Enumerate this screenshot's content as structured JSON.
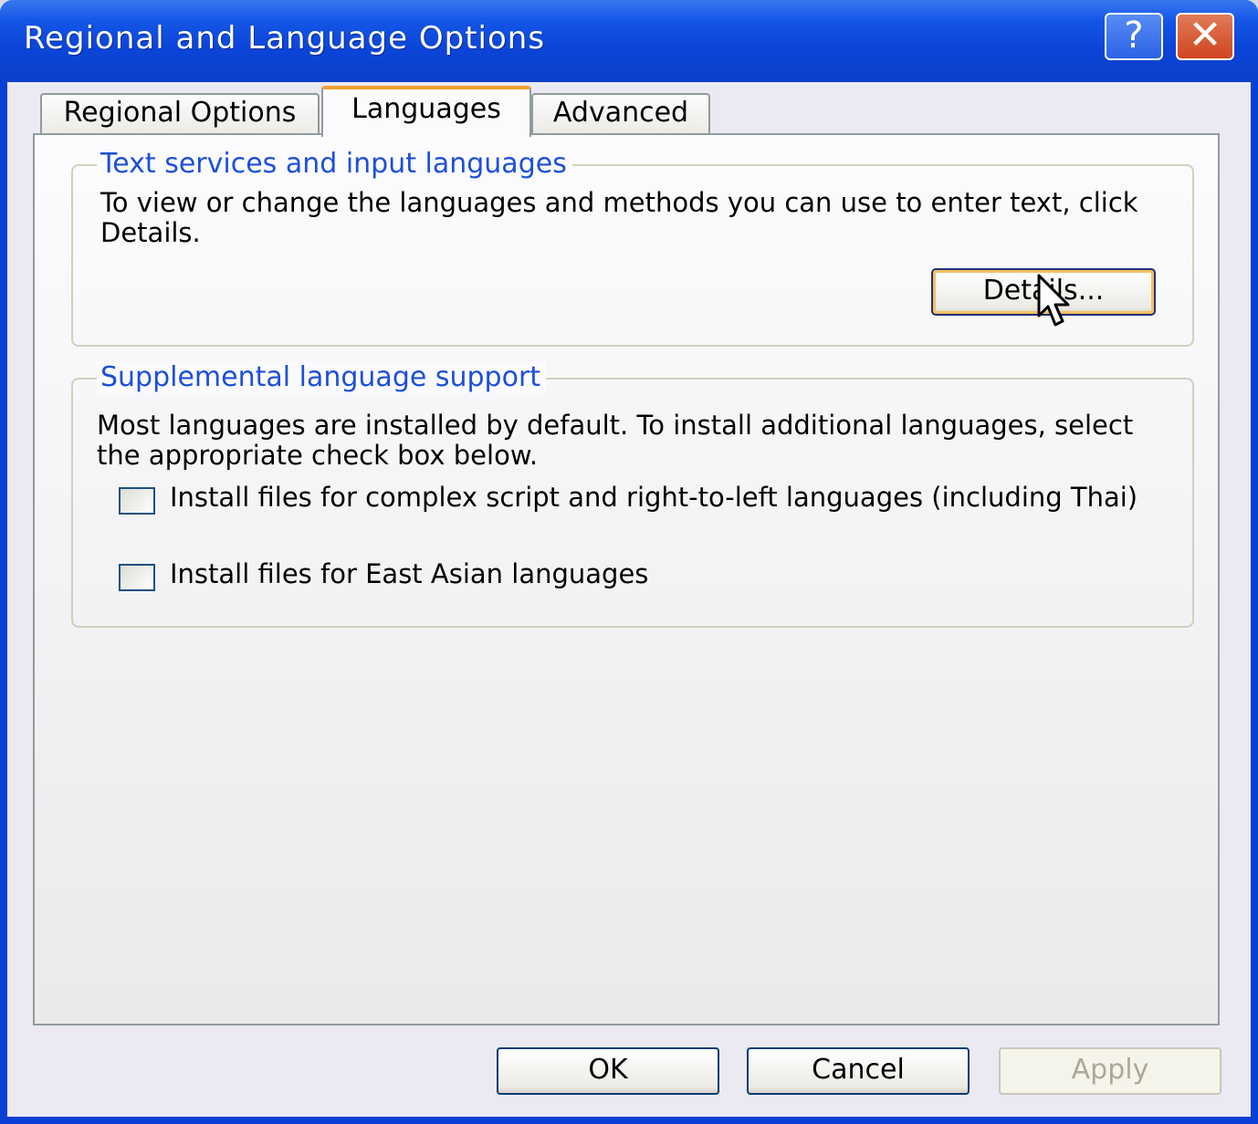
{
  "window": {
    "title": "Regional and Language Options",
    "help_label": "?",
    "close_label": "✕"
  },
  "tabs": [
    {
      "label": "Regional Options",
      "selected": false
    },
    {
      "label": "Languages",
      "selected": true
    },
    {
      "label": "Advanced",
      "selected": false
    }
  ],
  "text_services": {
    "heading": "Text services and input languages",
    "description": "To view or change the languages and methods you can use to enter text, click Details.",
    "details_label": "Details..."
  },
  "supplemental": {
    "heading": "Supplemental language support",
    "description": "Most languages are installed by default. To install additional languages, select the appropriate check box below.",
    "options": [
      {
        "label": "Install files for complex script and right-to-left languages (including Thai)",
        "checked": false
      },
      {
        "label": "Install files for East Asian languages",
        "checked": false
      }
    ]
  },
  "footer": {
    "ok_label": "OK",
    "cancel_label": "Cancel",
    "apply_label": "Apply",
    "apply_enabled": false
  },
  "colors": {
    "title_bar": "#0b44d8",
    "group_heading": "#1e4fd8",
    "selected_tab_accent": "#f0a030"
  }
}
